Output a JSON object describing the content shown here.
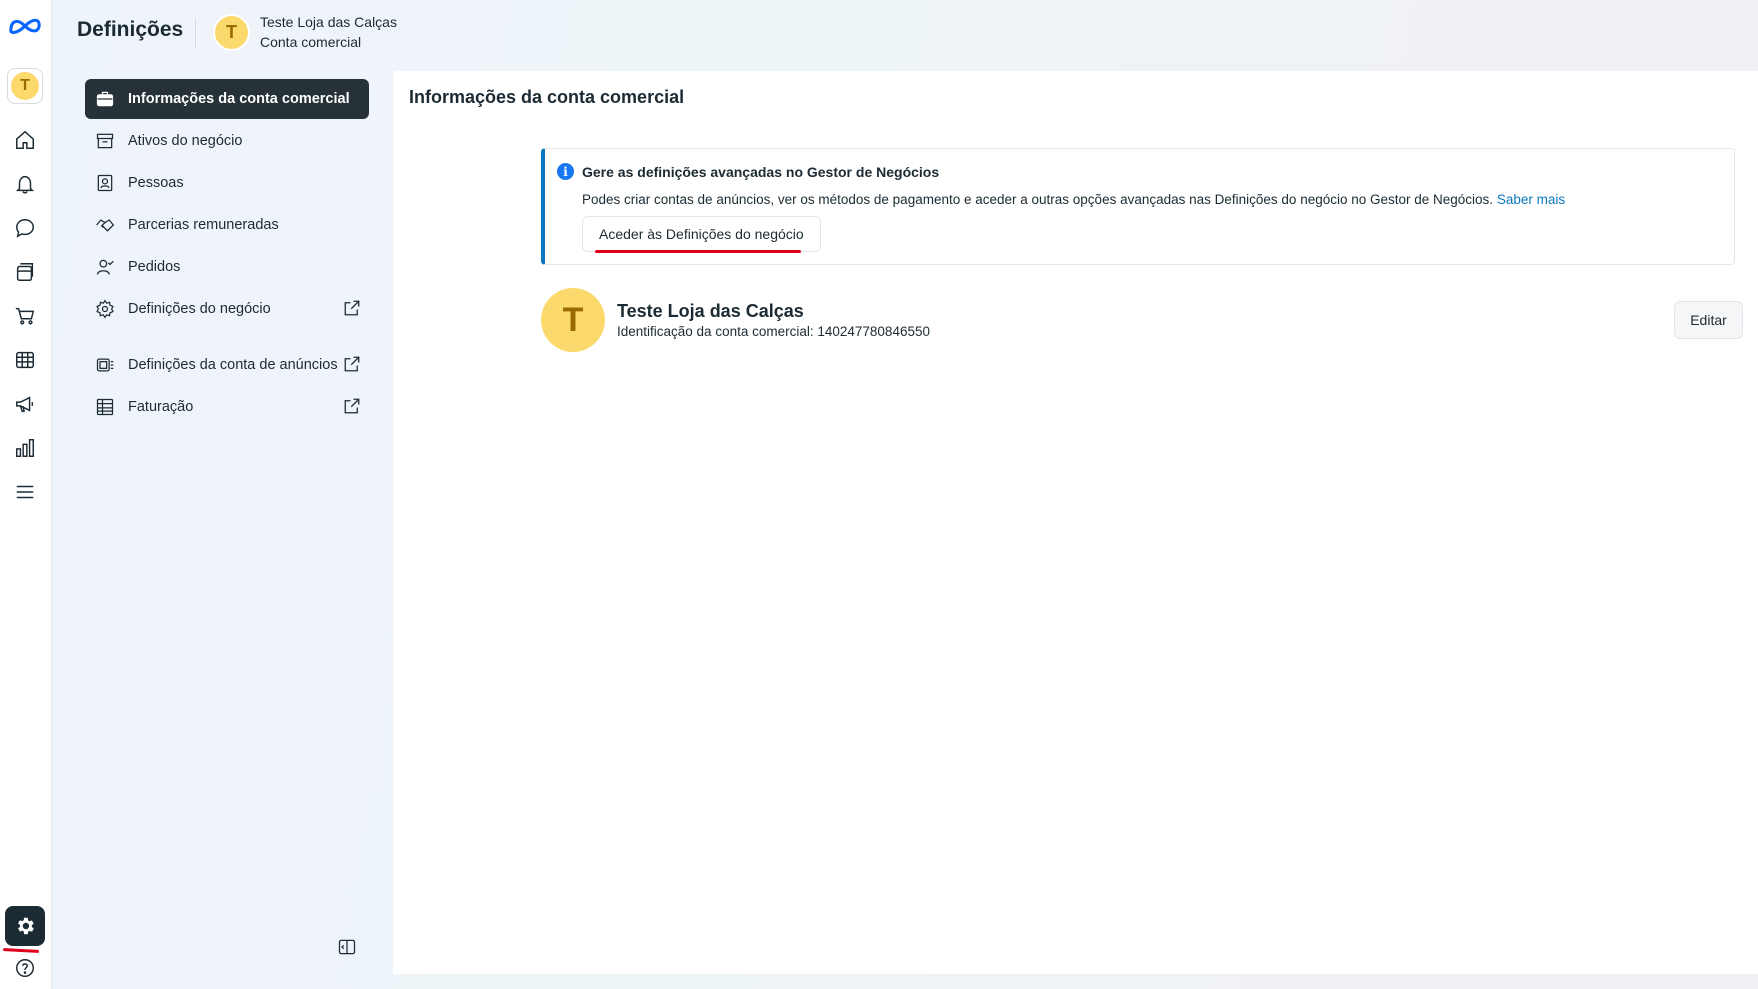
{
  "header": {
    "title": "Definições",
    "account_name": "Teste Loja das Calças",
    "account_type": "Conta comercial",
    "avatar_letter": "T"
  },
  "rail": {
    "avatar_letter": "T",
    "icons": [
      "meta-logo-icon",
      "home-icon",
      "bell-icon",
      "chat-bubble-icon",
      "pages-icon",
      "cart-icon",
      "table-icon",
      "megaphone-icon",
      "bar-chart-icon",
      "menu-icon",
      "gear-icon",
      "help-icon"
    ]
  },
  "sidebar": {
    "items": [
      {
        "label": "Informações da conta comercial",
        "icon": "briefcase-icon",
        "active": true,
        "external": false
      },
      {
        "label": "Ativos do negócio",
        "icon": "archive-box-icon",
        "active": false,
        "external": false
      },
      {
        "label": "Pessoas",
        "icon": "person-badge-icon",
        "active": false,
        "external": false
      },
      {
        "label": "Parcerias remuneradas",
        "icon": "handshake-icon",
        "active": false,
        "external": false
      },
      {
        "label": "Pedidos",
        "icon": "person-check-icon",
        "active": false,
        "external": false
      },
      {
        "label": "Definições do negócio",
        "icon": "gear-icon",
        "active": false,
        "external": true
      },
      {
        "label": "Definições da conta de anúncios",
        "icon": "ad-account-icon",
        "active": false,
        "external": true
      },
      {
        "label": "Faturação",
        "icon": "billing-icon",
        "active": false,
        "external": true
      }
    ]
  },
  "main": {
    "title": "Informações da conta comercial",
    "notice": {
      "title": "Gere as definições avançadas no Gestor de Negócios",
      "body": "Podes criar contas de anúncios, ver os métodos de pagamento e aceder a outras opções avançadas nas Definições do negócio no Gestor de Negócios.",
      "link": "Saber mais",
      "button": "Aceder às Definições do negócio"
    },
    "business": {
      "avatar_letter": "T",
      "name": "Teste Loja das Calças",
      "id_line": "Identificação da conta comercial: 140247780846550"
    },
    "edit_button": "Editar"
  },
  "colors": {
    "accent_blue": "#0a78be",
    "active_nav": "#263238",
    "avatar_yellow": "#fcd96d",
    "annotation_red": "#e0001b"
  }
}
